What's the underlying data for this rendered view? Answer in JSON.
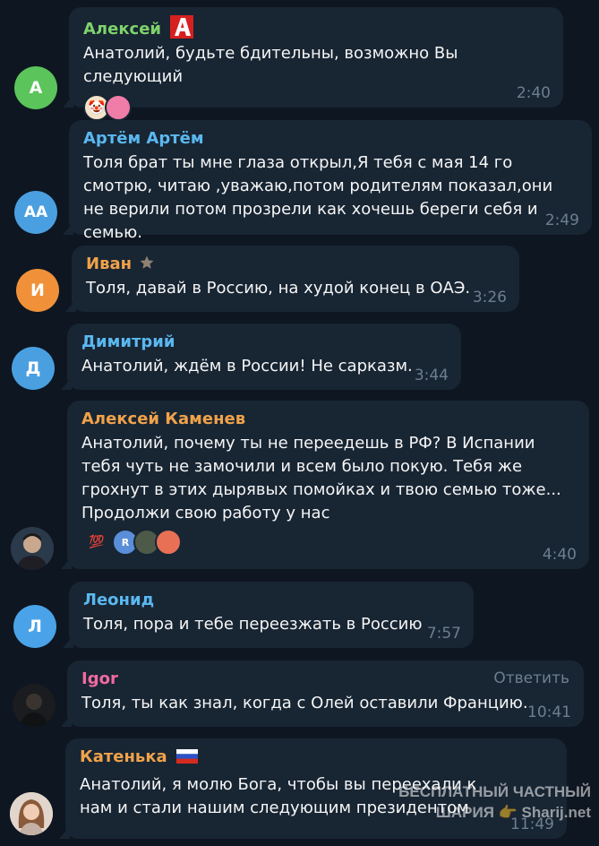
{
  "colors": {
    "background": "#0e1621",
    "bubble": "#182533",
    "time": "#6d7f8f"
  },
  "messages": [
    {
      "sender": "Алексей",
      "sender_color": "#7ed36a",
      "avatar_initials": "А",
      "avatar_color": "#5bc45a",
      "badge_icon": "red-letter-a-logo",
      "text": "Анатолий, будьте бдительны, возможно Вы следующий",
      "reactions": [
        "clown-face",
        "pink-circle"
      ],
      "time": "2:40"
    },
    {
      "sender": "Артём Артём",
      "sender_color": "#5ab8f0",
      "avatar_initials": "АА",
      "avatar_color": "#4a9fe0",
      "text": "Толя брат ты мне глаза открыл,Я тебя с мая 14 го смотрю, читаю ,уважаю,потом родителям показал,они не верили потом прозрели как хочешь береги себя и семью.",
      "time": "2:49"
    },
    {
      "sender": "Иван",
      "sender_color": "#f0a24a",
      "avatar_initials": "И",
      "avatar_color": "#f0913a",
      "badge_icon": "star-icon",
      "text": "Толя, давай в Россию, на худой конец в ОАЭ.",
      "time": "3:26"
    },
    {
      "sender": "Димитрий",
      "sender_color": "#5ab8f0",
      "avatar_initials": "Д",
      "avatar_color": "#4a9fe0",
      "text": "Анатолий, ждём в России! Не сарказм.",
      "time": "3:44"
    },
    {
      "sender": "Алексей Каменев",
      "sender_color": "#f0a24a",
      "avatar_icon": "user-photo",
      "text": "Анатолий, почему ты не переедешь в РФ? В Испании тебя чуть не замочили и всем было покую. Тебя же грохнут в этих дырявых помойках и твою семью тоже... Продолжи свою работу у нас",
      "reactions": [
        "hundred-points",
        "r-avatar",
        "photo-avatar",
        "orange-avatar"
      ],
      "reaction_r": "R",
      "time": "4:40"
    },
    {
      "sender": "Леонид",
      "sender_color": "#5ab8f0",
      "avatar_initials": "Л",
      "avatar_color": "#4aa3e8",
      "text": "Толя, пора и тебе переезжать в Россию",
      "time": "7:57"
    },
    {
      "sender": "Igor",
      "sender_color": "#f06aa0",
      "avatar_icon": "user-photo-dark",
      "reply_label": "Ответить",
      "text": "Толя, ты как знал, когда с Олей оставили Францию.",
      "time": "10:41"
    },
    {
      "sender": "Катенька",
      "sender_color": "#f0a24a",
      "avatar_icon": "user-photo-woman",
      "badge_icon": "russian-flag",
      "text": "Анатолий, я молю Бога, чтобы вы переехали к нам и стали нашим следующим президентом",
      "time": "11:49"
    }
  ],
  "watermark": {
    "line1": "БЕСПЛАТНЫЙ ЧАСТНЫЙ",
    "line2": "ШАРИЯ 👉 Sharij.net"
  }
}
